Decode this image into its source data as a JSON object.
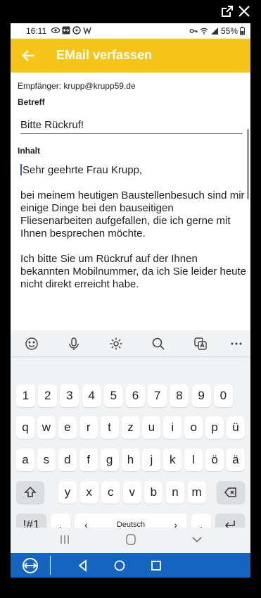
{
  "frame": {
    "external_icon": "external-link-icon",
    "close_icon": "close-icon"
  },
  "status_bar": {
    "time": "16:11",
    "battery": "55%"
  },
  "app_bar": {
    "title": "EMail verfassen",
    "back_icon": "arrow-left-icon",
    "color": "#f5c518"
  },
  "email": {
    "recipient": "Empfänger: krupp@krupp59.de",
    "subject_label": "Betreff",
    "subject": "Bitte Rückruf!",
    "content_label": "Inhalt",
    "body": [
      "Sehr geehrte Frau Krupp,",
      "bei meinem heutigen Baustellenbesuch sind mir einige Dinge bei den bauseitigen Fliesenarbeiten aufgefallen, die ich gerne mit Ihnen besprechen möchte.",
      "Ich bitte Sie um Rückruf auf der Ihnen bekannten Mobilnummer, da ich Sie leider heute nicht direkt erreicht habe."
    ]
  },
  "keyboard": {
    "toolbar": [
      "emoji-icon",
      "microphone-icon",
      "settings-icon",
      "search-icon",
      "translate-icon",
      "more-icon"
    ],
    "row1": [
      "1",
      "2",
      "3",
      "4",
      "5",
      "6",
      "7",
      "8",
      "9",
      "0"
    ],
    "row2": [
      "q",
      "w",
      "e",
      "r",
      "t",
      "z",
      "u",
      "i",
      "o",
      "p",
      "ü"
    ],
    "row3": [
      "a",
      "s",
      "d",
      "f",
      "g",
      "h",
      "j",
      "k",
      "l",
      "ö",
      "ä"
    ],
    "row4": [
      "y",
      "x",
      "c",
      "v",
      "b",
      "n",
      "m"
    ],
    "symbols_key": "!#1",
    "comma_key": ",",
    "space_label": "Deutsch",
    "period_key": "."
  },
  "bottom_bar": {
    "color": "#1565c0"
  }
}
